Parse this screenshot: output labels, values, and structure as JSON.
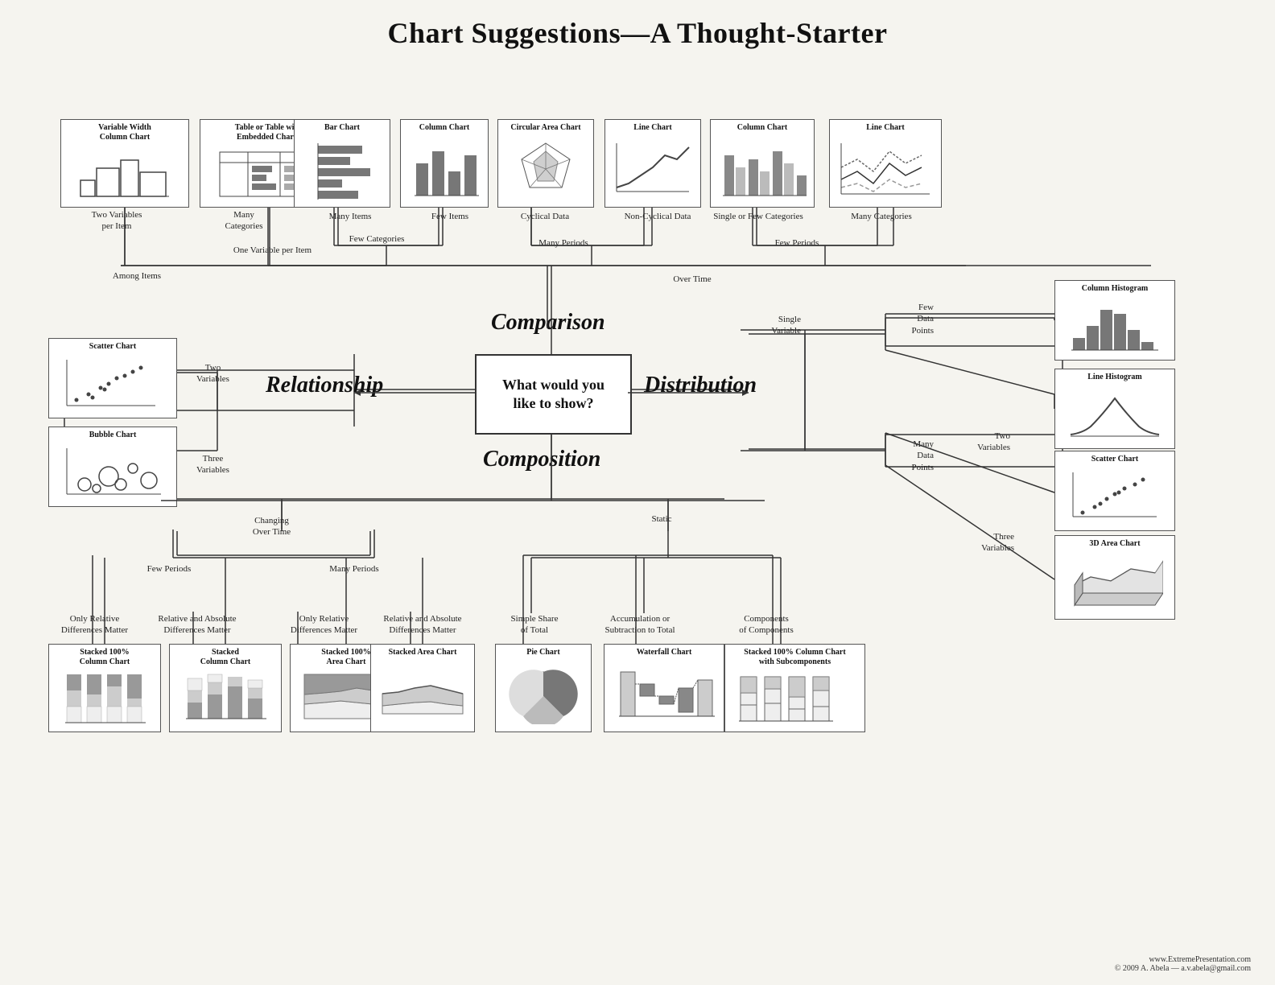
{
  "title": "Chart Suggestions—A Thought-Starter",
  "centerBox": {
    "line1": "What would you",
    "line2": "like to show?"
  },
  "categories": {
    "comparison": "Comparison",
    "relationship": "Relationship",
    "distribution": "Distribution",
    "composition": "Composition"
  },
  "chartBoxes": [
    {
      "id": "var-width-col",
      "title": "Variable Width\nColumn Chart"
    },
    {
      "id": "table-embedded",
      "title": "Table or Table with\nEmbedded Charts"
    },
    {
      "id": "bar-chart",
      "title": "Bar Chart"
    },
    {
      "id": "col-chart-few",
      "title": "Column Chart"
    },
    {
      "id": "circular-area",
      "title": "Circular Area Chart"
    },
    {
      "id": "line-chart-noncyclical",
      "title": "Line Chart"
    },
    {
      "id": "col-chart-fewcat",
      "title": "Column Chart"
    },
    {
      "id": "line-chart-manycat",
      "title": "Line Chart"
    },
    {
      "id": "scatter-rel",
      "title": "Scatter Chart"
    },
    {
      "id": "bubble-chart",
      "title": "Bubble Chart"
    },
    {
      "id": "col-histogram",
      "title": "Column Histogram"
    },
    {
      "id": "line-histogram",
      "title": "Line Histogram"
    },
    {
      "id": "scatter-dist",
      "title": "Scatter Chart"
    },
    {
      "id": "area-3d",
      "title": "3D Area Chart"
    },
    {
      "id": "stacked100-col",
      "title": "Stacked 100%\nColumn Chart"
    },
    {
      "id": "stacked-col",
      "title": "Stacked\nColumn Chart"
    },
    {
      "id": "stacked100-area",
      "title": "Stacked 100%\nArea Chart"
    },
    {
      "id": "stacked-area",
      "title": "Stacked Area Chart"
    },
    {
      "id": "pie-chart",
      "title": "Pie Chart"
    },
    {
      "id": "waterfall",
      "title": "Waterfall Chart"
    },
    {
      "id": "stacked100-subcomp",
      "title": "Stacked 100% Column Chart\nwith Subcomponents"
    }
  ],
  "labels": {
    "twoVarPerItem": "Two Variables\nper Item",
    "manyCategories": "Many\nCategories",
    "manyItems": "Many Items",
    "fewItems": "Few Items",
    "cyclicalData": "Cyclical Data",
    "nonCyclicalData": "Non-Cyclical Data",
    "singleFewCat": "Single or Few Categories",
    "manyCategories2": "Many Categories",
    "fewCategories": "Few Categories",
    "manyPeriods": "Many Periods",
    "fewPeriods": "Few Periods",
    "overTime": "Over Time",
    "oneVarPerItem": "One Variable per Item",
    "amongItems": "Among Items",
    "twoVariables": "Two\nVariables",
    "threeVariables": "Three\nVariables",
    "singleVariable": "Single\nVariable",
    "fewDataPoints": "Few\nData\nPoints",
    "manyDataPoints": "Many\nData\nPoints",
    "twoVariablesDist": "Two\nVariables",
    "threeVariablesDist": "Three\nVariables",
    "changingOverTime": "Changing\nOver Time",
    "static": "Static",
    "fewPeriods2": "Few Periods",
    "manyPeriods2": "Many Periods",
    "onlyRelative1": "Only Relative\nDifferences Matter",
    "relAndAbsolute1": "Relative and Absolute\nDifferences Matter",
    "onlyRelative2": "Only Relative\nDifferences Matter",
    "relAndAbsolute2": "Relative and Absolute\nDifferences Matter",
    "simpleShare": "Simple Share\nof Total",
    "accumulation": "Accumulation or\nSubtraction to Total",
    "components": "Components\nof Components",
    "footer1": "www.ExtremePresentation.com",
    "footer2": "© 2009  A. Abela — a.v.abela@gmail.com"
  }
}
